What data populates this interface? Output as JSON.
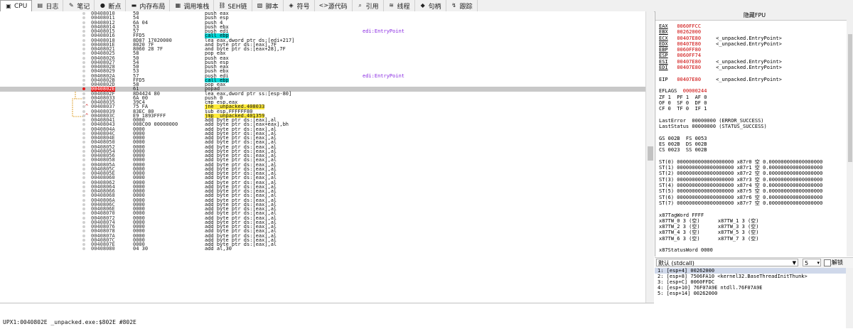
{
  "tabs": [
    {
      "label": "CPU",
      "icon": "cpu-icon",
      "glyph": "▣",
      "active": true
    },
    {
      "label": "日志",
      "icon": "log-icon",
      "glyph": "▤",
      "active": false
    },
    {
      "label": "笔记",
      "icon": "notes-icon",
      "glyph": "✎",
      "active": false
    },
    {
      "label": "断点",
      "icon": "breakpoint-icon",
      "glyph": "●",
      "active": false
    },
    {
      "label": "内存布局",
      "icon": "memory-map-icon",
      "glyph": "▬",
      "active": false
    },
    {
      "label": "调用堆栈",
      "icon": "call-stack-icon",
      "glyph": "▦",
      "active": false
    },
    {
      "label": "SEH链",
      "icon": "seh-icon",
      "glyph": "⛓",
      "active": false
    },
    {
      "label": "脚本",
      "icon": "script-icon",
      "glyph": "▧",
      "active": false
    },
    {
      "label": "符号",
      "icon": "symbols-icon",
      "glyph": "◈",
      "active": false
    },
    {
      "label": "源代码",
      "icon": "source-icon",
      "glyph": "<>",
      "active": false
    },
    {
      "label": "引用",
      "icon": "references-icon",
      "glyph": "⌕",
      "active": false
    },
    {
      "label": "线程",
      "icon": "threads-icon",
      "glyph": "≋",
      "active": false
    },
    {
      "label": "句柄",
      "icon": "handles-icon",
      "glyph": "◆",
      "active": false
    },
    {
      "label": "跟踪",
      "icon": "trace-icon",
      "glyph": "↯",
      "active": false
    }
  ],
  "disasm": {
    "rows": [
      {
        "addr": "00408010",
        "bytes": "50",
        "instr": "push eax",
        "cmt": "",
        "kind": "push"
      },
      {
        "addr": "00408011",
        "bytes": "54",
        "instr": "push esp",
        "cmt": "",
        "kind": "push"
      },
      {
        "addr": "00408012",
        "bytes": "6A 04",
        "instr": "push 4",
        "cmt": "",
        "kind": "push"
      },
      {
        "addr": "00408014",
        "bytes": "53",
        "instr": "push ebx",
        "cmt": "",
        "kind": "push"
      },
      {
        "addr": "00408015",
        "bytes": "57",
        "instr": "push edi",
        "cmt": "edi:EntryPoint",
        "kind": "push"
      },
      {
        "addr": "00408016",
        "bytes": "FFD5",
        "instr": "call ebp",
        "cmt": "",
        "kind": "call"
      },
      {
        "addr": "00408018",
        "bytes": "8D87 17020000",
        "instr": "lea eax,dword ptr ds:[edi+217]",
        "cmt": "",
        "kind": ""
      },
      {
        "addr": "0040801E",
        "bytes": "8020 7F",
        "instr": "and byte ptr ds:[eax],7F",
        "cmt": "",
        "kind": ""
      },
      {
        "addr": "00408021",
        "bytes": "8060 28 7F",
        "instr": "and byte ptr ds:[eax+28],7F",
        "cmt": "",
        "kind": ""
      },
      {
        "addr": "00408025",
        "bytes": "58",
        "instr": "pop eax",
        "cmt": "",
        "kind": "push"
      },
      {
        "addr": "00408026",
        "bytes": "50",
        "instr": "push eax",
        "cmt": "",
        "kind": "push"
      },
      {
        "addr": "00408027",
        "bytes": "54",
        "instr": "push esp",
        "cmt": "",
        "kind": "push"
      },
      {
        "addr": "00408028",
        "bytes": "50",
        "instr": "push eax",
        "cmt": "",
        "kind": "push"
      },
      {
        "addr": "00408029",
        "bytes": "53",
        "instr": "push ebx",
        "cmt": "",
        "kind": "push"
      },
      {
        "addr": "0040802A",
        "bytes": "57",
        "instr": "push edi",
        "cmt": "edi:EntryPoint",
        "kind": "push"
      },
      {
        "addr": "0040802B",
        "bytes": "FFD5",
        "instr": "call ebp",
        "cmt": "",
        "kind": "call"
      },
      {
        "addr": "0040802D",
        "bytes": "58",
        "instr": "pop eax",
        "cmt": "",
        "kind": "push"
      },
      {
        "addr": "0040802E",
        "bytes": "61",
        "instr": "popad",
        "cmt": "",
        "kind": "push",
        "sel": true
      },
      {
        "addr": "0040802F",
        "bytes": "8D4424 80",
        "instr": "lea eax,dword ptr ss:[esp-80]",
        "cmt": "",
        "kind": ""
      },
      {
        "addr": "00408033",
        "bytes": "6A 00",
        "instr": "push 0",
        "cmt": "",
        "kind": "push"
      },
      {
        "addr": "00408035",
        "bytes": "39C4",
        "instr": "cmp esp,eax",
        "cmt": "",
        "kind": ""
      },
      {
        "addr": "00408037",
        "bytes": "75 FA",
        "instr": "jne _unpacked.408033",
        "cmt": "",
        "kind": "jmp",
        "arr": "^"
      },
      {
        "addr": "00408039",
        "bytes": "83EC 80",
        "instr": "sub esp,FFFFFF80",
        "cmt": "",
        "kind": ""
      },
      {
        "addr": "0040803C",
        "bytes": "E9 1893FFFF",
        "instr": "jmp _unpacked.401359",
        "cmt": "",
        "kind": "jmp",
        "arr": "^"
      },
      {
        "addr": "00408041",
        "bytes": "0000",
        "instr": "add byte ptr ds:[eax],al",
        "cmt": "",
        "kind": ""
      },
      {
        "addr": "00408043",
        "bytes": "008C00 00000000",
        "instr": "add byte ptr ds:[eax+eax],bh",
        "cmt": "",
        "kind": ""
      },
      {
        "addr": "0040804A",
        "bytes": "0000",
        "instr": "add byte ptr ds:[eax],al",
        "cmt": "",
        "kind": ""
      },
      {
        "addr": "0040804C",
        "bytes": "0000",
        "instr": "add byte ptr ds:[eax],al",
        "cmt": "",
        "kind": ""
      },
      {
        "addr": "0040804E",
        "bytes": "0000",
        "instr": "add byte ptr ds:[eax],al",
        "cmt": "",
        "kind": ""
      },
      {
        "addr": "00408050",
        "bytes": "0000",
        "instr": "add byte ptr ds:[eax],al",
        "cmt": "",
        "kind": ""
      },
      {
        "addr": "00408052",
        "bytes": "0000",
        "instr": "add byte ptr ds:[eax],al",
        "cmt": "",
        "kind": ""
      },
      {
        "addr": "00408054",
        "bytes": "0000",
        "instr": "add byte ptr ds:[eax],al",
        "cmt": "",
        "kind": ""
      },
      {
        "addr": "00408056",
        "bytes": "0000",
        "instr": "add byte ptr ds:[eax],al",
        "cmt": "",
        "kind": ""
      },
      {
        "addr": "00408058",
        "bytes": "0000",
        "instr": "add byte ptr ds:[eax],al",
        "cmt": "",
        "kind": ""
      },
      {
        "addr": "0040805A",
        "bytes": "0000",
        "instr": "add byte ptr ds:[eax],al",
        "cmt": "",
        "kind": ""
      },
      {
        "addr": "0040805C",
        "bytes": "0000",
        "instr": "add byte ptr ds:[eax],al",
        "cmt": "",
        "kind": ""
      },
      {
        "addr": "0040805E",
        "bytes": "0000",
        "instr": "add byte ptr ds:[eax],al",
        "cmt": "",
        "kind": ""
      },
      {
        "addr": "00408060",
        "bytes": "0000",
        "instr": "add byte ptr ds:[eax],al",
        "cmt": "",
        "kind": ""
      },
      {
        "addr": "00408062",
        "bytes": "0000",
        "instr": "add byte ptr ds:[eax],al",
        "cmt": "",
        "kind": ""
      },
      {
        "addr": "00408064",
        "bytes": "0000",
        "instr": "add byte ptr ds:[eax],al",
        "cmt": "",
        "kind": ""
      },
      {
        "addr": "00408066",
        "bytes": "0000",
        "instr": "add byte ptr ds:[eax],al",
        "cmt": "",
        "kind": ""
      },
      {
        "addr": "00408068",
        "bytes": "0000",
        "instr": "add byte ptr ds:[eax],al",
        "cmt": "",
        "kind": ""
      },
      {
        "addr": "0040806A",
        "bytes": "0000",
        "instr": "add byte ptr ds:[eax],al",
        "cmt": "",
        "kind": ""
      },
      {
        "addr": "0040806C",
        "bytes": "0000",
        "instr": "add byte ptr ds:[eax],al",
        "cmt": "",
        "kind": ""
      },
      {
        "addr": "0040806E",
        "bytes": "0000",
        "instr": "add byte ptr ds:[eax],al",
        "cmt": "",
        "kind": ""
      },
      {
        "addr": "00408070",
        "bytes": "0000",
        "instr": "add byte ptr ds:[eax],al",
        "cmt": "",
        "kind": ""
      },
      {
        "addr": "00408072",
        "bytes": "0000",
        "instr": "add byte ptr ds:[eax],al",
        "cmt": "",
        "kind": ""
      },
      {
        "addr": "00408074",
        "bytes": "0000",
        "instr": "add byte ptr ds:[eax],al",
        "cmt": "",
        "kind": ""
      },
      {
        "addr": "00408076",
        "bytes": "0000",
        "instr": "add byte ptr ds:[eax],al",
        "cmt": "",
        "kind": ""
      },
      {
        "addr": "00408078",
        "bytes": "0000",
        "instr": "add byte ptr ds:[eax],al",
        "cmt": "",
        "kind": ""
      },
      {
        "addr": "0040807A",
        "bytes": "0000",
        "instr": "add byte ptr ds:[eax],al",
        "cmt": "",
        "kind": ""
      },
      {
        "addr": "0040807C",
        "bytes": "0000",
        "instr": "add byte ptr ds:[eax],al",
        "cmt": "",
        "kind": ""
      },
      {
        "addr": "0040807E",
        "bytes": "0000",
        "instr": "add byte ptr ds:[eax],al",
        "cmt": "",
        "kind": ""
      },
      {
        "addr": "00408080",
        "bytes": "04 30",
        "instr": "add al,30",
        "cmt": "",
        "kind": ""
      }
    ]
  },
  "status": {
    "text": "UPX1:0040802E _unpacked.exe:$802E #802E"
  },
  "regpane": {
    "title": "隐藏FPU",
    "regs": [
      {
        "name": "EAX",
        "val": "0060FFCC",
        "sym": ""
      },
      {
        "name": "EBX",
        "val": "00262000",
        "sym": ""
      },
      {
        "name": "ECX",
        "val": "00407E80",
        "sym": "<_unpacked.EntryPoint>"
      },
      {
        "name": "EDX",
        "val": "00407E80",
        "sym": "<_unpacked.EntryPoint>"
      },
      {
        "name": "EBP",
        "val": "0060FF80",
        "sym": ""
      },
      {
        "name": "ESP",
        "val": "0060FF74",
        "sym": ""
      },
      {
        "name": "ESI",
        "val": "00407E80",
        "sym": "<_unpacked.EntryPoint>"
      },
      {
        "name": "EDI",
        "val": "00407E80",
        "sym": "<_unpacked.EntryPoint>"
      }
    ],
    "eip": {
      "name": "EIP",
      "val": "00407E80",
      "sym": "<_unpacked.EntryPoint>"
    },
    "eflags": {
      "label": "EFLAGS",
      "val": "00000244"
    },
    "flag_lines": [
      "ZF 1  PF 1  AF 0",
      "OF 0  SF 0  DF 0",
      "CF 0  TF 0  IF 1"
    ],
    "error_lines": [
      "LastError  00000000 (ERROR_SUCCESS)",
      "LastStatus 00000000 (STATUS_SUCCESS)"
    ],
    "seg_lines": [
      "GS 002B  FS 0053",
      "ES 002B  DS 002B",
      "CS 0023  SS 002B"
    ],
    "st_lines": [
      "ST(0) 0000000000000000000 x87r0 空 0.000000000000000000",
      "ST(1) 0000000000000000000 x87r1 空 0.000000000000000000",
      "ST(2) 0000000000000000000 x87r2 空 0.000000000000000000",
      "ST(3) 0000000000000000000 x87r3 空 0.000000000000000000",
      "ST(4) 0000000000000000000 x87r4 空 0.000000000000000000",
      "ST(5) 0000000000000000000 x87r5 空 0.000000000000000000",
      "ST(6) 0000000000000000000 x87r6 空 0.000000000000000000",
      "ST(7) 0000000000000000000 x87r7 空 0.000000000000000000"
    ],
    "tag_lines": [
      "x87TagWord FFFF",
      "x87TW_0 3 (空)      x87TW_1 3 (空)",
      "x87TW_2 3 (空)      x87TW_3 3 (空)",
      "x87TW_4 3 (空)      x87TW_5 3 (空)",
      "x87TW_6 3 (空)      x87TW_7 3 (空)"
    ],
    "status_word": "x87StatusWord 0000"
  },
  "stackbar": {
    "convention": "默认 (stdcall)",
    "argc": "5",
    "unlock_label": "解锁"
  },
  "stack": [
    {
      "text": "1: [esp+4] 00262000",
      "sel": true
    },
    {
      "text": "2: [esp+8] 7506FA10 <kernel32.BaseThreadInitThunk>",
      "sel": false
    },
    {
      "text": "3: [esp+C] 0060FFDC",
      "sel": false
    },
    {
      "text": "4: [esp+10] 76F07A9E ntdll.76F07A9E",
      "sel": false
    },
    {
      "text": "5: [esp+14] 00262000",
      "sel": false
    }
  ],
  "colors": {
    "selected_addr_bg": "#e41a1a",
    "call_hl": "#00d7d7",
    "jmp_hl": "#ffeb3b",
    "comment": "#8a2be2",
    "reg_changed": "#cc0000"
  }
}
